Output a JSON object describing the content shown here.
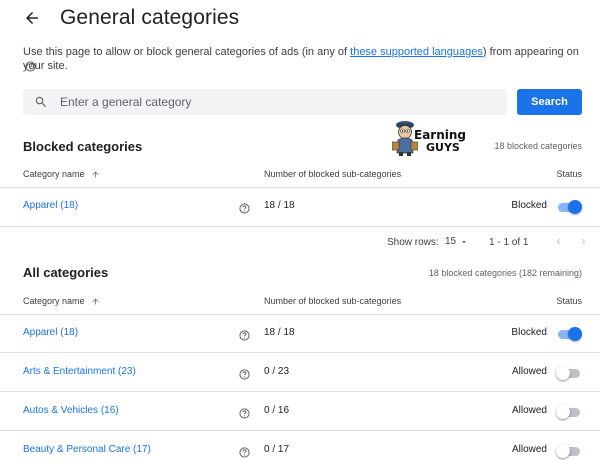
{
  "header": {
    "title": "General categories"
  },
  "description": {
    "before": "Use this page to allow or block general categories of ads (in any of ",
    "link": "these supported languages",
    "after": ") from appearing on your site."
  },
  "search": {
    "placeholder": "Enter a general category",
    "button_label": "Search"
  },
  "logo": {
    "line1": "Earning",
    "line2": "GUYS"
  },
  "blocked_section": {
    "title": "Blocked categories",
    "count": "18 blocked categories",
    "columns": {
      "name": "Category name",
      "sub": "Number of blocked sub-categories",
      "status": "Status"
    },
    "rows": [
      {
        "name": "Apparel (18)",
        "sub": "18 / 18",
        "status": "Blocked",
        "enabled": true
      }
    ],
    "pagination": {
      "show_rows_label": "Show rows:",
      "rows_value": "15",
      "range": "1 - 1 of 1"
    }
  },
  "all_section": {
    "title": "All categories",
    "count": "18 blocked categories (182 remaining)",
    "columns": {
      "name": "Category name",
      "sub": "Number of blocked sub-categories",
      "status": "Status"
    },
    "rows": [
      {
        "name": "Apparel (18)",
        "sub": "18 / 18",
        "status": "Blocked",
        "enabled": true
      },
      {
        "name": "Arts & Entertainment (23)",
        "sub": "0 / 23",
        "status": "Allowed",
        "enabled": false
      },
      {
        "name": "Autos & Vehicles (16)",
        "sub": "0 / 16",
        "status": "Allowed",
        "enabled": false
      },
      {
        "name": "Beauty & Personal Care (17)",
        "sub": "0 / 17",
        "status": "Allowed",
        "enabled": false
      }
    ]
  },
  "colors": {
    "accent": "#1a73e8",
    "toggle_track_on": "#8ab4f8",
    "divider": "#e0e0e0"
  }
}
